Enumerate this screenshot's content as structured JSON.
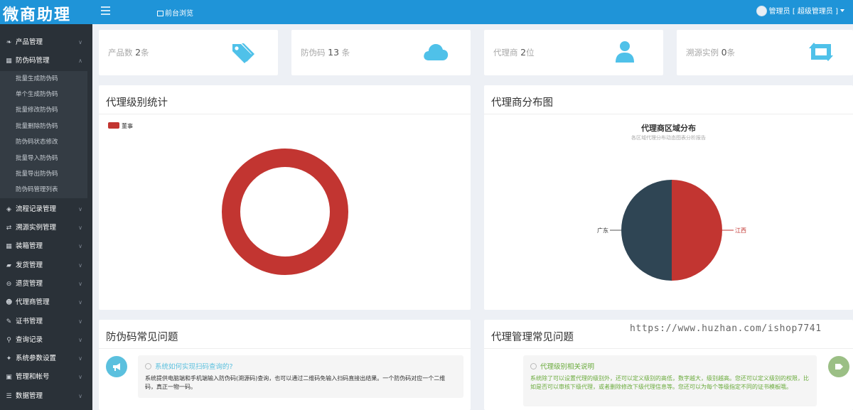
{
  "header": {
    "brand": "微商助理",
    "front_link": "前台浏览",
    "user_label": "管理员 [ 超级管理员 ]"
  },
  "sidebar": {
    "items": [
      {
        "label": "产品管理",
        "icon": "leaf-icon"
      },
      {
        "label": "防伪码管理",
        "icon": "barcode-icon",
        "open": true
      },
      {
        "label": "流程记录管理",
        "icon": "tags-icon"
      },
      {
        "label": "溯源实例管理",
        "icon": "retweet-icon"
      },
      {
        "label": "装箱管理",
        "icon": "grid-icon"
      },
      {
        "label": "发货管理",
        "icon": "truck-icon"
      },
      {
        "label": "退货管理",
        "icon": "minus-circle-icon"
      },
      {
        "label": "代理商管理",
        "icon": "users-icon"
      },
      {
        "label": "证书管理",
        "icon": "pencil-icon"
      },
      {
        "label": "查询记录",
        "icon": "search-icon"
      },
      {
        "label": "系统参数设置",
        "icon": "wrench-icon"
      },
      {
        "label": "管理和帐号",
        "icon": "lock-icon"
      },
      {
        "label": "数据管理",
        "icon": "list-icon"
      }
    ],
    "sub_items": [
      "批量生成防伪码",
      "单个生成防伪码",
      "批量修改防伪码",
      "批量删除防伪码",
      "防伪码状态修改",
      "批量导入防伪码",
      "批量导出防伪码",
      "防伪码管理列表"
    ]
  },
  "stats": [
    {
      "label": "产品数",
      "value": "2",
      "unit": "条",
      "icon": "tags-icon"
    },
    {
      "label": "防伪码",
      "value": "13",
      "unit": "条",
      "icon": "cloud-icon"
    },
    {
      "label": "代理商",
      "value": "2",
      "unit": "位",
      "icon": "user-icon"
    },
    {
      "label": "溯源实例",
      "value": "0",
      "unit": "条",
      "icon": "retweet-icon"
    }
  ],
  "panels": {
    "agent_level": {
      "title": "代理级别统计"
    },
    "agent_dist": {
      "title": "代理商分布图"
    },
    "anticounterfeit_faq": {
      "title": "防伪码常见问题"
    },
    "agent_faq": {
      "title": "代理管理常见问题"
    }
  },
  "chart_data": [
    {
      "type": "pie",
      "variant": "donut",
      "categories": [
        "董事"
      ],
      "values": [
        1
      ],
      "legend": "top-left",
      "colors": [
        "#c23531"
      ]
    },
    {
      "type": "pie",
      "title": "代理商区域分布",
      "subtitle": "各区域代理分布动态图表分析报告",
      "categories": [
        "江西",
        "广东"
      ],
      "values": [
        1,
        1
      ],
      "colors": [
        "#c23531",
        "#2f4554"
      ]
    }
  ],
  "faq": {
    "left": {
      "question": "系统如何实现扫码查询的?",
      "answer": "系统提供电脑端和手机端输入防伪码(溯源码)查询，也可以通过二维码免输入扫码直接出结果。一个防伪码对应一个二维码，真正一物一码。",
      "color": "#5bc0de"
    },
    "right": {
      "question": "代理级别相关说明",
      "answer": "系统除了可以设置代理的级别外，还可以定义级别的高低，数字越大，级别越高。您还可以定义级别的权限，比如是否可以审核下级代理，或者删除修改下级代理信息等。您还可以为每个等级指定不同的证书模板哦。",
      "color": "#6aab3c"
    }
  },
  "watermark": "https://www.huzhan.com/ishop7741",
  "colors": {
    "header": "#1f94d8",
    "sidebar": "#2a3138",
    "stat_icon": "#4fc1e9",
    "series_red": "#c23531",
    "series_dark": "#2f4554"
  }
}
